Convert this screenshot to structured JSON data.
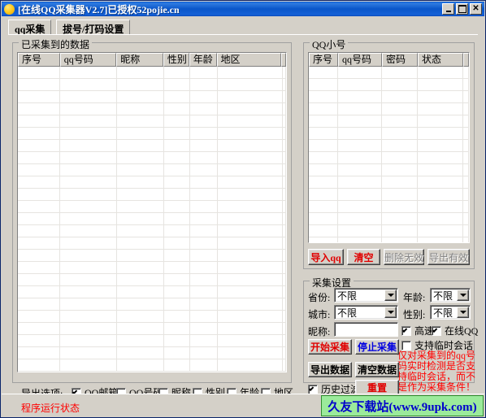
{
  "window": {
    "title": "[在线QQ采集器V2.7]已授权52pojie.cn",
    "icon": "app-globe-icon",
    "controls": {
      "minimize": "_",
      "maximize": "□",
      "close": "✕"
    }
  },
  "tabs": [
    {
      "label": "qq采集",
      "selected": true
    },
    {
      "label": "拔号/打码设置",
      "selected": false
    }
  ],
  "collected_panel": {
    "legend": "已采集到的数据",
    "columns": [
      "序号",
      "qq号码",
      "昵称",
      "性别",
      "年龄",
      "地区"
    ],
    "rows": []
  },
  "small_account_panel": {
    "legend": "QQ小号",
    "columns": [
      "序号",
      "qq号码",
      "密码",
      "状态"
    ],
    "rows": [],
    "buttons": [
      {
        "label": "导入qq",
        "style": "red",
        "enabled": true
      },
      {
        "label": "清空",
        "style": "red",
        "enabled": true
      },
      {
        "label": "删除无效",
        "style": "disabled",
        "enabled": false
      },
      {
        "label": "导出有效",
        "style": "disabled",
        "enabled": false
      }
    ]
  },
  "settings_panel": {
    "legend": "采集设置",
    "fields": {
      "province_label": "省份:",
      "province_value": "不限",
      "age_label": "年龄:",
      "age_value": "不限",
      "city_label": "城市:",
      "city_value": "不限",
      "gender_label": "性别:",
      "gender_value": "不限",
      "nickname_label": "昵称:",
      "nickname_value": "",
      "nickname_placeholder": ""
    },
    "checkboxes": [
      {
        "label": "高速",
        "checked": true
      },
      {
        "label": "在线QQ",
        "checked": true
      },
      {
        "label": "支持临时会话",
        "checked": false
      },
      {
        "label": "历史过滤",
        "checked": true
      }
    ],
    "buttons": [
      {
        "label": "开始采集",
        "style": "red"
      },
      {
        "label": "停止采集",
        "style": "blue"
      },
      {
        "label": "导出数据",
        "style": "normal"
      },
      {
        "label": "清空数据",
        "style": "normal"
      },
      {
        "label": "重置",
        "style": "red"
      }
    ],
    "warning": "仅对采集到的qq号码实时检测是否支持临时会话，而不是作为采集条件！"
  },
  "export_options": {
    "label": "导出选项:",
    "items": [
      {
        "label": "QQ邮箱",
        "checked": true
      },
      {
        "label": "QQ号码",
        "checked": false
      },
      {
        "label": "昵称",
        "checked": false
      },
      {
        "label": "性别",
        "checked": false
      },
      {
        "label": "年龄",
        "checked": false
      },
      {
        "label": "地区",
        "checked": false
      }
    ]
  },
  "statusbar": {
    "text": "程序运行状态",
    "watermark": "久友下载站(www.9upk.com)"
  },
  "colors": {
    "title_bar": "#0a56c9",
    "face": "#d4d0c8",
    "red": "#ff0000",
    "blue": "#0000e0",
    "watermark_bg": "#9bea9b",
    "watermark_fg": "#0000cc"
  }
}
